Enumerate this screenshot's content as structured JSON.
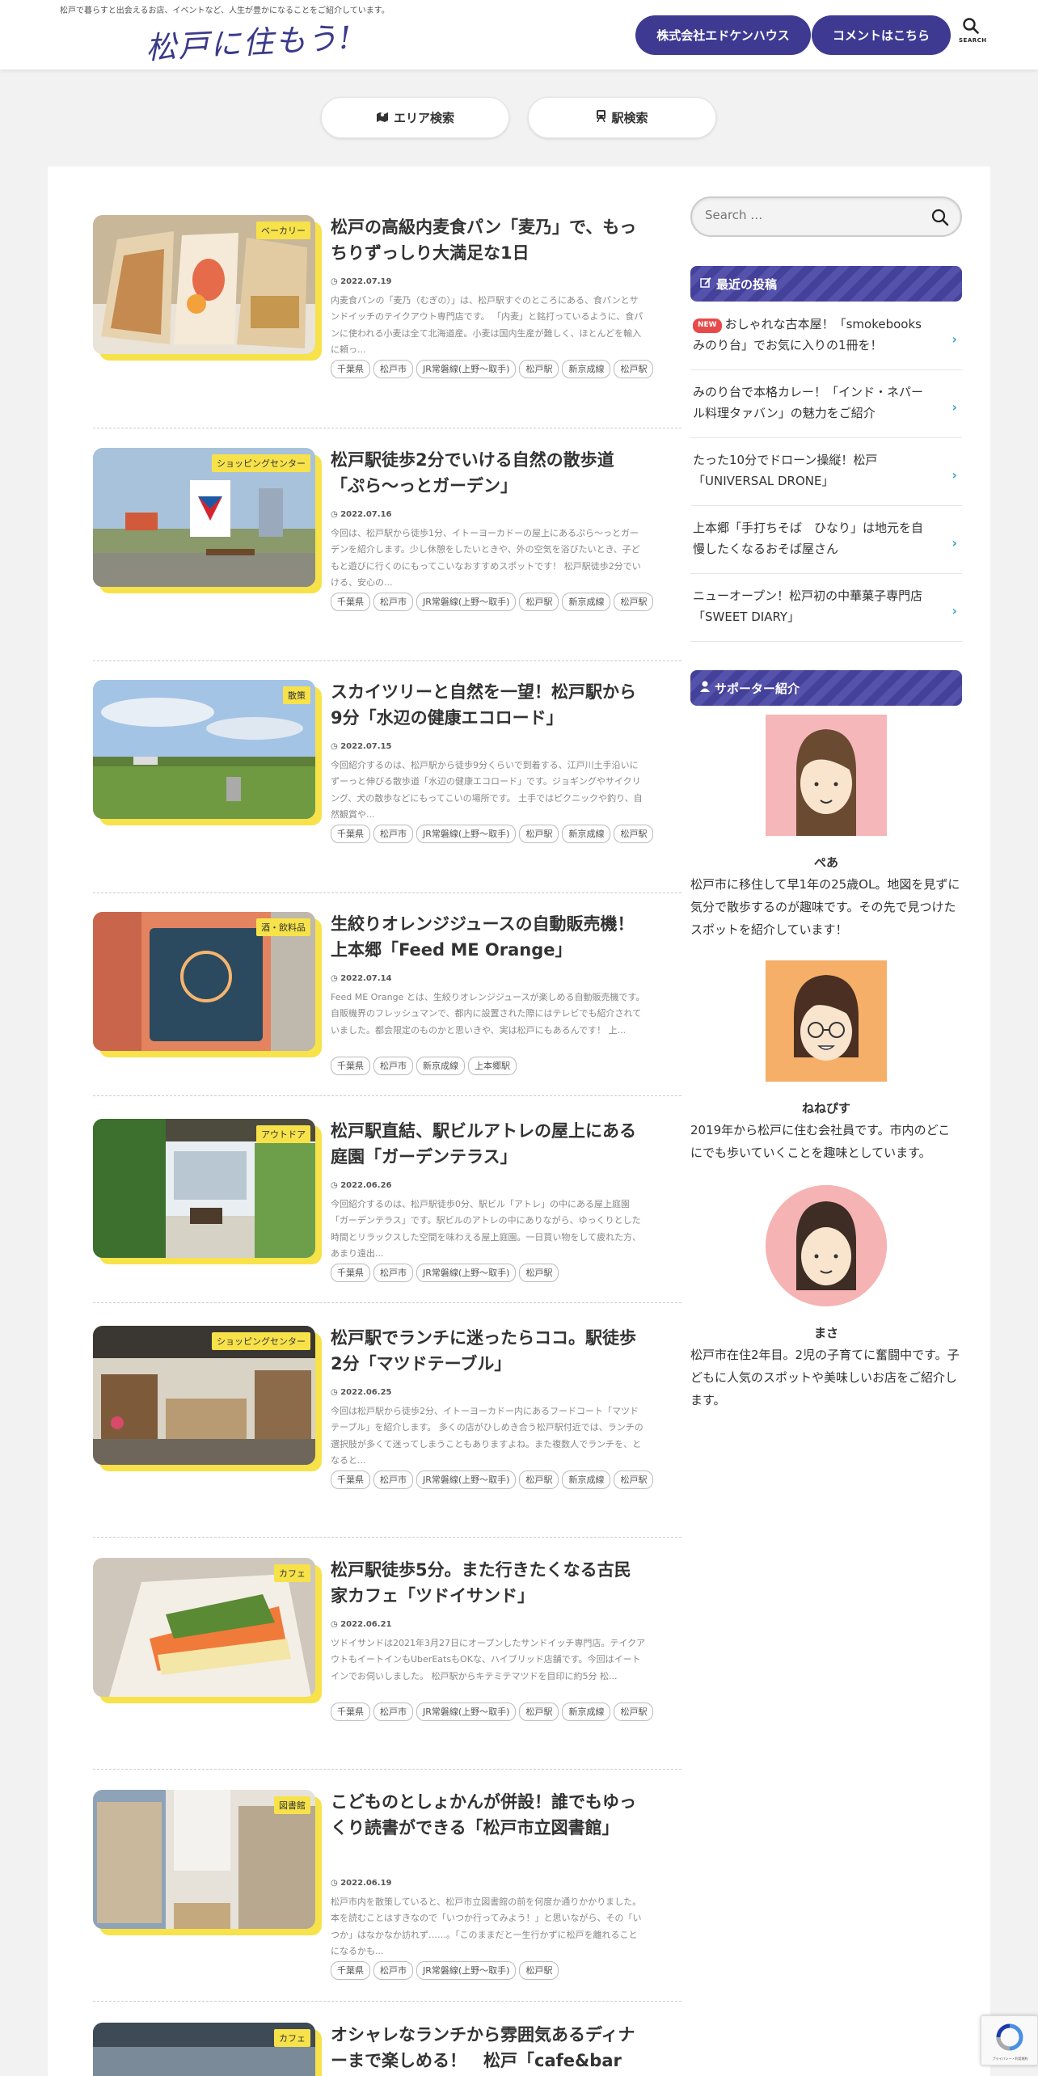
{
  "header": {
    "tagline": "松戸で暮らすと出会えるお店、イベントなど、人生が豊かになることをご紹介しています。",
    "logo": "松戸に住もう!",
    "buttons": [
      "株式会社エドケンハウス",
      "コメントはこちら"
    ],
    "search_label": "SEARCH"
  },
  "nav": {
    "area_search": "エリア検索",
    "station_search": "駅検索"
  },
  "posts": [
    {
      "category": "ベーカリー",
      "title": "松戸の高級内麦食パン「麦乃」で、もっちりずっしり大満足な1日",
      "date": "2022.07.19",
      "excerpt": "内麦食パンの「麦乃（むぎの）」は、松戸駅すぐのところにある、食パンとサンドイッチのテイクアウト専門店です。 「内麦」と銘打っているように、食パンに使われる小麦は全て北海道産。小麦は国内生産が難しく、ほとんどを輸入に頼っ...",
      "tags": [
        "千葉県",
        "松戸市",
        "JR常磐線(上野～取手)",
        "松戸駅",
        "新京成線",
        "松戸駅"
      ]
    },
    {
      "category": "ショッピングセンター",
      "title": "松戸駅徒歩2分でいける自然の散歩道「ぷら〜っとガーデン」",
      "date": "2022.07.16",
      "excerpt": "今回は、松戸駅から徒歩1分、イトーヨーカドーの屋上にあるぷら〜っとガーデンを紹介します。少し休憩をしたいときや、外の空気を浴びたいとき、子どもと遊びに行くのにもってこいなおすすめスポットです！ 松戸駅徒歩2分でいける、安心の...",
      "tags": [
        "千葉県",
        "松戸市",
        "JR常磐線(上野～取手)",
        "松戸駅",
        "新京成線",
        "松戸駅"
      ]
    },
    {
      "category": "散策",
      "title": "スカイツリーと自然を一望！松戸駅から9分「水辺の健康エコロード」",
      "date": "2022.07.15",
      "excerpt": "今回紹介するのは、松戸駅から徒歩9分くらいで到着する、江戸川土手沿いにずーっと伸びる散歩道「水辺の健康エコロード」です。ジョギングやサイクリング、犬の散歩などにもってこいの場所です。 土手ではピクニックや釣り、自然観賞や...",
      "tags": [
        "千葉県",
        "松戸市",
        "JR常磐線(上野～取手)",
        "松戸駅",
        "新京成線",
        "松戸駅"
      ]
    },
    {
      "category": "酒・飲料品",
      "title": "生絞りオレンジジュースの自動販売機！上本郷「Feed ME Orange」",
      "date": "2022.07.14",
      "excerpt": "Feed ME Orange とは、生絞りオレンジジュースが楽しめる自動販売機です。自販機界のフレッシュマンで、都内に設置された際にはテレビでも紹介されていました。都会限定のものかと思いきや、実は松戸にもあるんです！ 上...",
      "tags": [
        "千葉県",
        "松戸市",
        "新京成線",
        "上本郷駅"
      ]
    },
    {
      "category": "アウトドア",
      "title": "松戸駅直結、駅ビルアトレの屋上にある庭園「ガーデンテラス」",
      "date": "2022.06.26",
      "excerpt": "今回紹介するのは、松戸駅徒歩0分、駅ビル「アトレ」の中にある屋上庭園「ガーデンテラス」です。駅ビルのアトレの中にありながら、ゆっくりとした時間とリラックスした空間を味わえる屋上庭園。一日買い物をして疲れた方、あまり遠出...",
      "tags": [
        "千葉県",
        "松戸市",
        "JR常磐線(上野～取手)",
        "松戸駅"
      ]
    },
    {
      "category": "ショッピングセンター",
      "title": "松戸駅でランチに迷ったらココ。駅徒歩2分「マツドテーブル」",
      "date": "2022.06.25",
      "excerpt": "今回は松戸駅から徒歩2分、イトーヨーカドー内にあるフードコート「マツドテーブル」を紹介します。 多くの店がひしめき合う松戸駅付近では、ランチの選択肢が多くて迷ってしまうこともありますよね。また複数人でランチを、となると...",
      "tags": [
        "千葉県",
        "松戸市",
        "JR常磐線(上野～取手)",
        "松戸駅",
        "新京成線",
        "松戸駅"
      ]
    },
    {
      "category": "カフェ",
      "title": "松戸駅徒歩5分。また行きたくなる古民家カフェ「ツドイサンド」",
      "date": "2022.06.21",
      "excerpt": "ツドイサンドは2021年3月27日にオープンしたサンドイッチ専門店。テイクアウトもイートインもUberEatsもOKな、ハイブリッド店舗です。今回はイートインでお伺いしました。 松戸駅からキテミテマツドを目印に約5分 松...",
      "tags": [
        "千葉県",
        "松戸市",
        "JR常磐線(上野～取手)",
        "松戸駅",
        "新京成線",
        "松戸駅"
      ]
    },
    {
      "category": "図書館",
      "title": "こどものとしょかんが併設！誰でもゆっくり読書ができる「松戸市立図書館」",
      "date": "2022.06.19",
      "excerpt": "松戸市内を散策していると、松戸市立図書館の前を何度か通りかかりました。本を読むことはすきなので「いつか行ってみよう！」と思いながら、その「いつか」はなかなか訪れず……。「このままだと一生行かずに松戸を離れることになるかも...",
      "tags": [
        "千葉県",
        "松戸市",
        "JR常磐線(上野～取手)",
        "松戸駅"
      ]
    },
    {
      "category": "カフェ",
      "title": "オシャレなランチから雰囲気あるディナーまで楽しめる！　松戸「cafe&bar"
    }
  ],
  "sidebar": {
    "search_placeholder": "Search …",
    "recent_title": "最近の投稿",
    "new_badge": "NEW",
    "recent": [
      "おしゃれな古本屋！「smokebooksみのり台」でお気に入りの1冊を！",
      "みのり台で本格カレー！「インド・ネパール料理タァバン」の魅力をご紹介",
      "たった10分でドローン操縦！松戸「UNIVERSAL DRONE」",
      "上本郷「手打ちそば　ひなり」は地元を自慢したくなるおそば屋さん",
      "ニューオープン！松戸初の中華菓子専門店「SWEET DIARY」"
    ],
    "supporter_title": "サポーター紹介",
    "supporters": [
      {
        "name": "ぺあ",
        "desc": "松戸市に移住して早1年の25歳OL。地図を見ずに気分で散歩するのが趣味です。その先で見つけたスポットを紹介しています！"
      },
      {
        "name": "ねねぴす",
        "desc": "2019年から松戸に住む会社員です。市内のどこにでも歩いていくことを趣味としています。"
      },
      {
        "name": "まさ",
        "desc": "松戸市在住2年目。2児の子育てに奮闘中です。子どもに人気のスポットや美味しいお店をご紹介します。"
      }
    ]
  },
  "recaptcha": {
    "text": "プライバシー・利用規約"
  }
}
